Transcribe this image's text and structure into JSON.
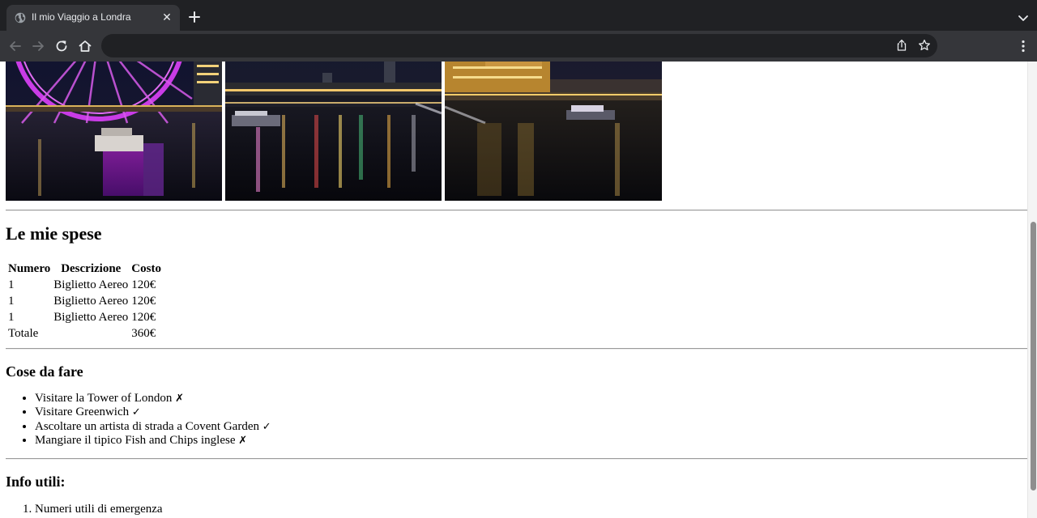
{
  "browser": {
    "tab_title": "Il mio Viaggio a Londra",
    "address": ""
  },
  "icons": {
    "tab": "globe-icon",
    "close": "close-icon",
    "new_tab": "plus-icon",
    "tab_list": "chevron-down-icon",
    "back": "back-arrow-icon",
    "forward": "forward-arrow-icon",
    "reload": "reload-icon",
    "home": "home-icon",
    "share": "share-icon",
    "bookmark": "star-icon",
    "menu": "kebab-menu-icon"
  },
  "gallery": {
    "photos": [
      {
        "name": "london-eye-night-photo"
      },
      {
        "name": "thames-bridge-night-photo"
      },
      {
        "name": "westminster-night-photo"
      }
    ]
  },
  "expenses": {
    "heading": "Le mie spese",
    "columns": [
      "Numero",
      "Descrizione",
      "Costo"
    ],
    "rows": [
      {
        "numero": "1",
        "descrizione": "Biglietto Aereo",
        "costo": "120€"
      },
      {
        "numero": "1",
        "descrizione": "Biglietto Aereo",
        "costo": "120€"
      },
      {
        "numero": "1",
        "descrizione": "Biglietto Aereo",
        "costo": "120€"
      }
    ],
    "total_label": "Totale",
    "total_value": "360€"
  },
  "todo": {
    "heading": "Cose da fare",
    "items": [
      {
        "text": "Visitare la Tower of London",
        "mark": "✗"
      },
      {
        "text": "Visitare Greenwich",
        "mark": "✓"
      },
      {
        "text": "Ascoltare un artista di strada a Covent Garden",
        "mark": "✓"
      },
      {
        "text": "Mangiare il tipico Fish and Chips inglese",
        "mark": "✗"
      }
    ]
  },
  "info": {
    "heading": "Info utili:",
    "items": [
      "Numeri utili di emergenza"
    ]
  },
  "colors": {
    "chrome_dark": "#202124",
    "chrome_tab": "#35363a",
    "chrome_text": "#e8eaed"
  }
}
